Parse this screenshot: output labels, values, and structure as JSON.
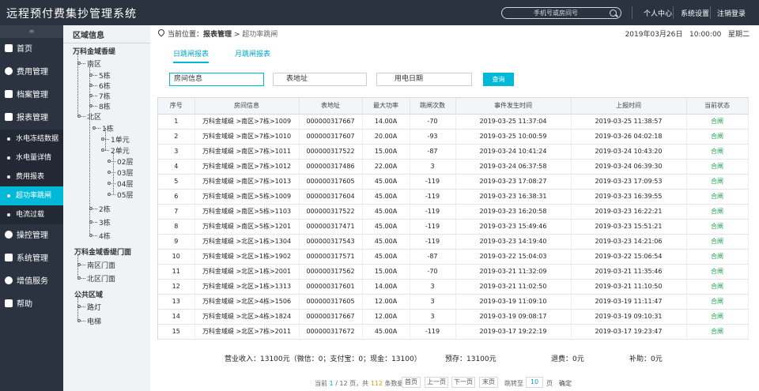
{
  "header": {
    "title": "远程预付费集抄管理系统",
    "search_placeholder": "手机号或房间号",
    "links": [
      "个人中心",
      "系统设置",
      "注销登录"
    ]
  },
  "sidebar": {
    "collapse": "≡",
    "items": [
      {
        "label": "首页",
        "icon": "home-icon"
      },
      {
        "label": "费用管理",
        "icon": "dollar-icon"
      },
      {
        "label": "档案管理",
        "icon": "archive-icon"
      },
      {
        "label": "报表管理",
        "icon": "report-icon"
      }
    ],
    "subitems": [
      "水电冻结数据",
      "水电量详情",
      "费用报表",
      "超功率跳闸",
      "电流过载"
    ],
    "active_sub": 3,
    "items2": [
      {
        "label": "操控管理",
        "icon": "control-icon"
      },
      {
        "label": "系统管理",
        "icon": "system-icon"
      },
      {
        "label": "增值服务",
        "icon": "service-icon"
      },
      {
        "label": "帮助",
        "icon": "help-icon"
      }
    ]
  },
  "region": {
    "title": "区域信息",
    "tree": [
      "万科金域香缇",
      "南区",
      "5栋",
      "6栋",
      "7栋",
      "8栋",
      "北区",
      "1栋",
      "1单元",
      "2单元",
      "02层",
      "03层",
      "04层",
      "05层",
      "2栋",
      "3栋",
      "4栋",
      "万科金域香缇门面",
      "南区门面",
      "北区门面",
      "公共区域",
      "路灯",
      "电梯"
    ]
  },
  "breadcrumb": {
    "prefix": "当前位置：",
    "section": "报表管理",
    "sep": " > ",
    "current": "超功率跳闸"
  },
  "datetime": {
    "date": "2019年03月26日",
    "time": "10:00:00",
    "weekday": "星期二"
  },
  "tabs": [
    "日跳闸报表",
    "月跳闸报表"
  ],
  "filters": {
    "room": "房间信息",
    "meter": "表地址",
    "date": "用电日期",
    "query": "查询"
  },
  "table": {
    "headers": [
      "序号",
      "房间信息",
      "表地址",
      "最大功率",
      "跳闸次数",
      "事件发生时间",
      "上报时间",
      "当前状态"
    ],
    "rows": [
      [
        "1",
        "万科金域缇 >南区>7栋>1009",
        "000000317667",
        "14.00A",
        "-70",
        "2019-03-25  11:37:04",
        "2019-03-25  11:38:57",
        "合闸"
      ],
      [
        "2",
        "万科金域缇 >南区>7栋>1010",
        "000000317607",
        "20.00A",
        "-93",
        "2019-03-25  10:00:59",
        "2019-03-26  04:02:18",
        "合闸"
      ],
      [
        "3",
        "万科金域缇 >南区>7栋>1011",
        "000000317522",
        "15.00A",
        "-87",
        "2019-03-24  10:41:24",
        "2019-03-24  10:43:20",
        "合闸"
      ],
      [
        "4",
        "万科金域缇 >南区>7栋>1012",
        "000000317486",
        "22.00A",
        "3",
        "2019-03-24  06:37:58",
        "2019-03-24  06:39:30",
        "合闸"
      ],
      [
        "5",
        "万科金域缇 >南区>7栋>1013",
        "000000317605",
        "45.00A",
        "-119",
        "2019-03-23  17:08:27",
        "2019-03-23  17:09:53",
        "合闸"
      ],
      [
        "6",
        "万科金域缇 >南区>5栋>1009",
        "000000317604",
        "45.00A",
        "-119",
        "2019-03-23  16:38:31",
        "2019-03-23  16:39:55",
        "合闸"
      ],
      [
        "7",
        "万科金域缇 >南区>5栋>1103",
        "000000317522",
        "45.00A",
        "-119",
        "2019-03-23  16:20:58",
        "2019-03-23  16:22:21",
        "合闸"
      ],
      [
        "8",
        "万科金域缇 >南区>5栋>1201",
        "000000317471",
        "45.00A",
        "-119",
        "2019-03-23  15:49:46",
        "2019-03-23  15:51:21",
        "合闸"
      ],
      [
        "9",
        "万科金域缇 >北区>1栋>1304",
        "000000317543",
        "45.00A",
        "-119",
        "2019-03-23  14:19:40",
        "2019-03-23  14:21:06",
        "合闸"
      ],
      [
        "10",
        "万科金域缇 >北区>1栋>1902",
        "000000317571",
        "45.00A",
        "-87",
        "2019-03-22  15:04:03",
        "2019-03-22  15:06:54",
        "合闸"
      ],
      [
        "11",
        "万科金域缇 >北区>1栋>2001",
        "000000317562",
        "15.00A",
        "-70",
        "2019-03-21  11:32:09",
        "2019-03-21  11:35:46",
        "合闸"
      ],
      [
        "12",
        "万科金域缇 >北区>1栋>1313",
        "000000317601",
        "14.00A",
        "3",
        "2019-03-21  11:02:50",
        "2019-03-21  11:10:50",
        "合闸"
      ],
      [
        "13",
        "万科金域缇 >北区>4栋>1506",
        "000000317605",
        "12.00A",
        "3",
        "2019-03-19  11:09:10",
        "2019-03-19  11:11:47",
        "合闸"
      ],
      [
        "14",
        "万科金域缇 >北区>4栋>1824",
        "000000317667",
        "12.00A",
        "3",
        "2019-03-19  09:08:17",
        "2019-03-19  09:10:31",
        "合闸"
      ],
      [
        "15",
        "万科金域缇 >北区>7栋>2011",
        "000000317672",
        "45.00A",
        "-119",
        "2019-03-17  19:22:19",
        "2019-03-17  19:23:47",
        "合闸"
      ]
    ]
  },
  "summary": {
    "revenue": "营业收入：13100元（微信：0；支付宝：0；现金：13100）",
    "prepaid": "预存：13100元",
    "refund": "退费：0元",
    "subsidy": "补助：0元"
  },
  "pager": {
    "prefix": "当前",
    "page": "1",
    "total_pages": "/ 12 页，共",
    "count": "112",
    "suffix": "条数据",
    "first": "首页",
    "prev": "上一页",
    "next": "下一页",
    "last": "末页",
    "goto": "跳转至",
    "goto_value": "10",
    "page_unit": "页",
    "confirm": "确定"
  }
}
